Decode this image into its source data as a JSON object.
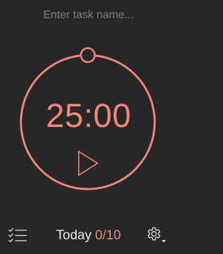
{
  "task": {
    "placeholder": "Enter task name...",
    "value": ""
  },
  "timer": {
    "time": "25:00",
    "progress": 0
  },
  "footer": {
    "today_label": "Today",
    "completed": "0",
    "separator": "/",
    "goal": "10"
  },
  "icons": {
    "list": "checklist-icon",
    "play": "play-icon",
    "settings": "gear-icon",
    "dropdown": "caret-down-icon"
  },
  "colors": {
    "background": "#272727",
    "accent": "#f0857a",
    "placeholder": "#7d7d7d",
    "text": "#e6e6e6",
    "icon": "#e0e0e0"
  }
}
